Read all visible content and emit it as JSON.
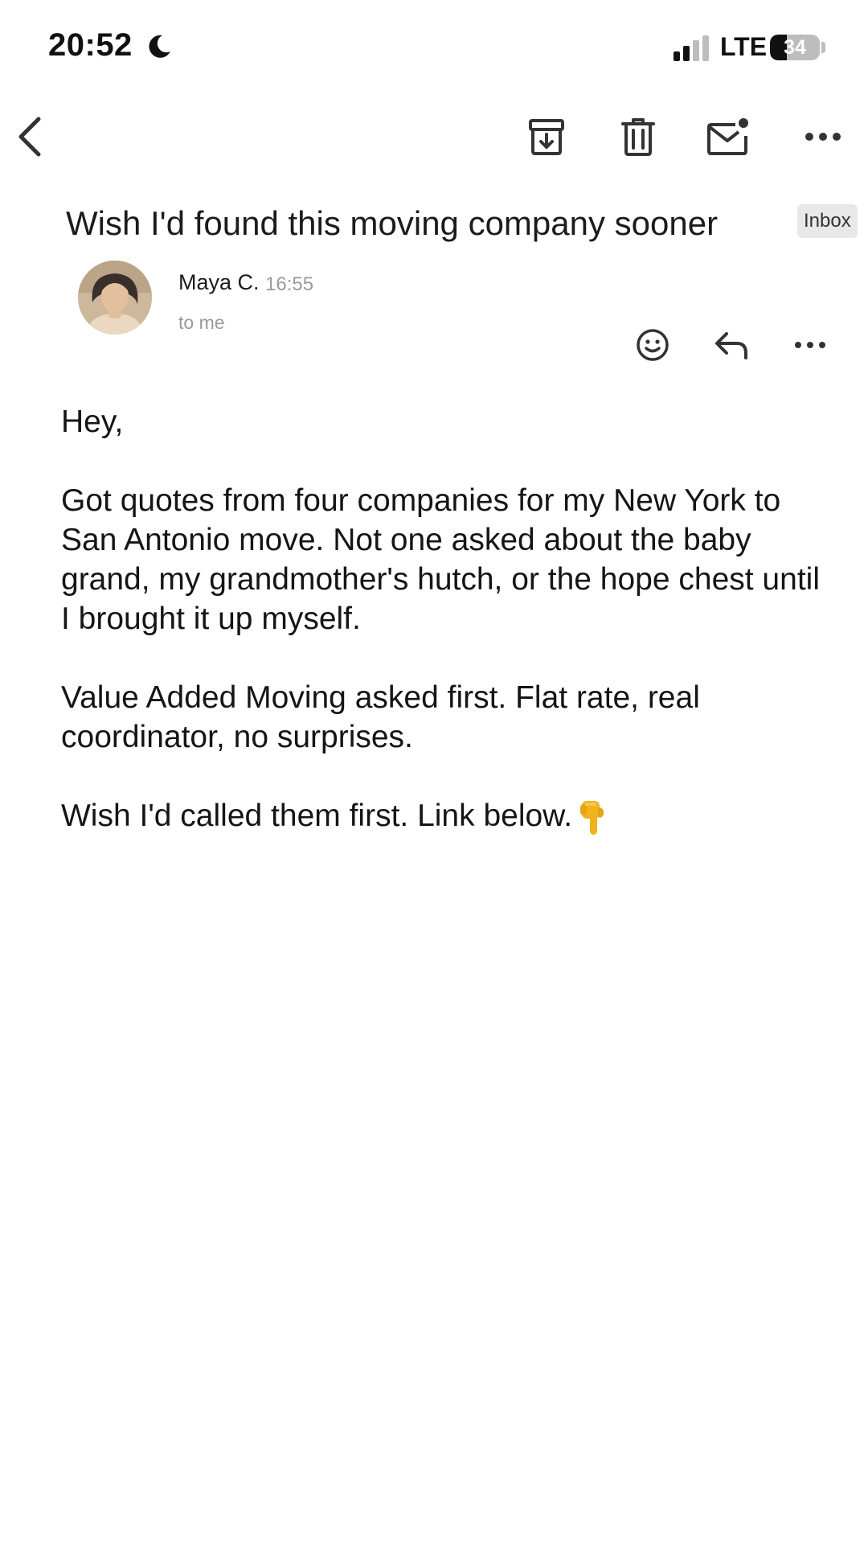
{
  "status_bar": {
    "time": "20:52",
    "network": "LTE",
    "battery_level": "34",
    "battery_fraction": 0.34,
    "icons": [
      "moon-icon",
      "signal-icon",
      "battery-icon"
    ]
  },
  "toolbar": {
    "icons": [
      "back-arrow-icon",
      "archive-icon",
      "trash-icon",
      "mark-unread-icon",
      "more-icon"
    ]
  },
  "email": {
    "subject": "Wish I'd found this moving company sooner",
    "label": "Inbox",
    "sender": {
      "name": "Maya C.",
      "time": "16:55",
      "recipient": "to me"
    },
    "actions": {
      "icons": [
        "emoji-react-icon",
        "reply-icon",
        "more-icon"
      ]
    },
    "body": {
      "greeting": "Hey,",
      "paragraph1": "Got quotes from four companies for my New York to San Antonio move. Not one asked about the baby grand, my grandmother's hutch, or the hope chest until I brought it up myself.",
      "paragraph2": "Value Added Moving asked first. Flat rate, real coordinator, no surprises.",
      "paragraph3": "Wish I'd called them first. Link below.",
      "closing_emoji": "pointing-down-icon"
    }
  },
  "colors": {
    "background": "#ffffff",
    "text": "#151515",
    "muted": "#9a9a9a",
    "chip_bg": "#e8e8e8",
    "icon": "#333333",
    "emoji": "#f2b21b"
  }
}
